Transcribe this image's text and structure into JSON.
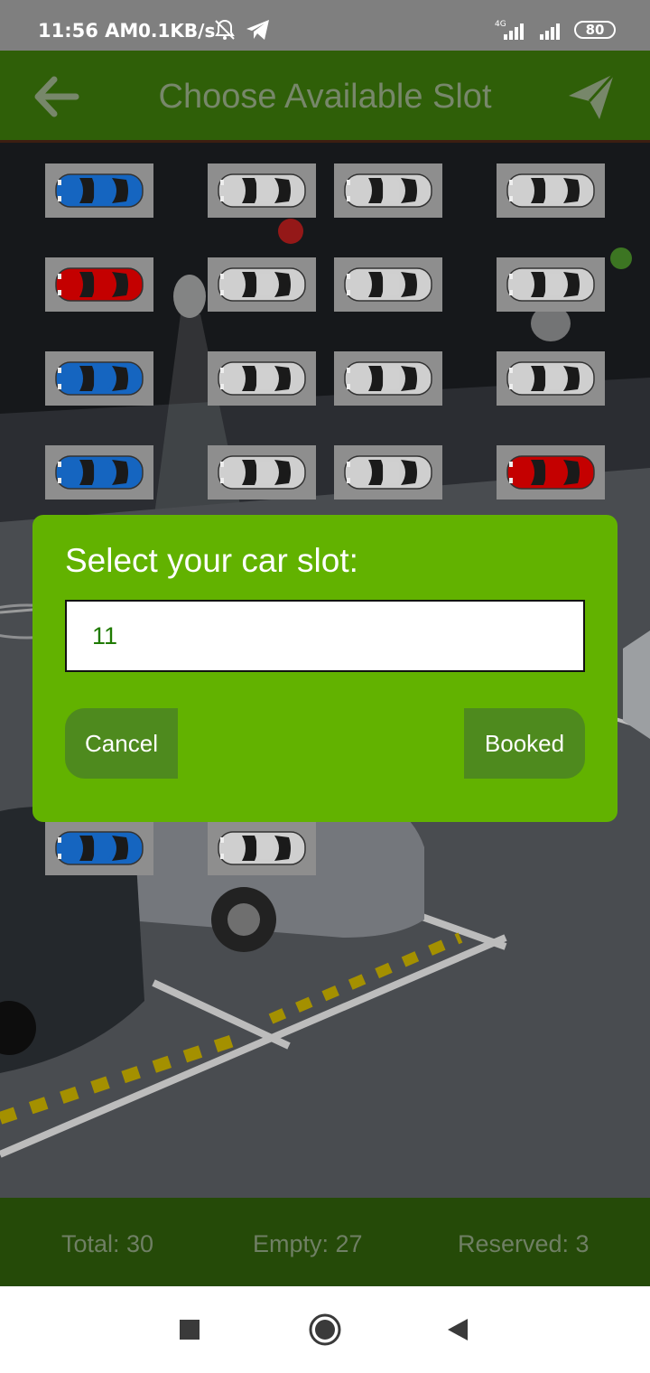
{
  "status_bar": {
    "time": "11:56 AM",
    "speed": "0.1KB/s",
    "network": "4G",
    "battery": "80",
    "icons": [
      "muted-bell-icon",
      "telegram-icon",
      "signal-icon",
      "wifi-icon",
      "battery-icon"
    ]
  },
  "app_bar": {
    "title": "Choose Available Slot",
    "back_icon": "arrow-left-icon",
    "action_icon": "send-icon"
  },
  "slots": {
    "rows": [
      [
        "blue",
        "grey",
        "grey",
        "grey"
      ],
      [
        "red",
        "grey",
        "grey",
        "grey"
      ],
      [
        "blue",
        "grey",
        "grey",
        "grey"
      ],
      [
        "blue",
        "grey",
        "grey",
        "red"
      ],
      [
        "blue",
        "grey"
      ]
    ]
  },
  "dialog": {
    "title": "Select your car slot:",
    "slot_value": "11",
    "cancel_label": "Cancel",
    "booked_label": "Booked"
  },
  "stats": {
    "total": "Total: 30",
    "empty": "Empty: 27",
    "reserved": "Reserved: 3"
  },
  "nav": {
    "recents_icon": "square-icon",
    "home_icon": "circle-icon",
    "back_icon": "triangle-back-icon"
  },
  "colors": {
    "app_bar": "#2f5f08",
    "dialog": "#62b200",
    "dialog_button": "#4e8a1e",
    "stats_bar": "#254a08",
    "car_blue": "#1565c0",
    "car_red": "#c40000",
    "car_grey": "#cfcfcf"
  }
}
